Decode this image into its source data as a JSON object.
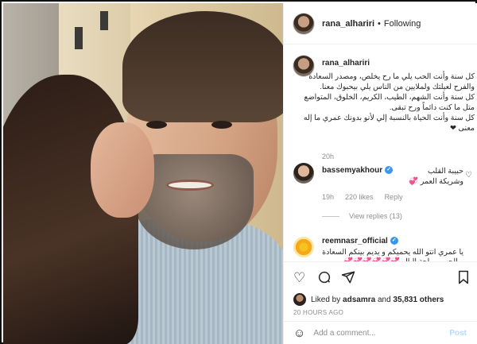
{
  "post_author": {
    "username": "rana_alhariri",
    "follow_separator": "•",
    "follow_status": "Following"
  },
  "caption": {
    "username": "rana_alhariri",
    "text": "كل سنة وأنت الحب يلي ما رح يخلص، ومصدر السعادة والفرح لعيلتك ولملايين من الناس يلي بيحبوك معنا.\nكل سنة وأنت الشهم، الطيب، الكريم، الخلوق، المتواضع متل ما كنت دائماً ورح تبقى.\nكل سنة وأنت الحياة بالنسبة إلي لأنو بدونك عمري ما إله معنى ❤",
    "time": "20h"
  },
  "comments": [
    {
      "username": "bassemyakhour",
      "verified": true,
      "text": "حبيبة القلب وشريكة العمر 💞",
      "time": "19h",
      "likes": "220 likes",
      "reply_label": "Reply",
      "view_replies": "View replies (13)"
    },
    {
      "username": "reemnasr_official",
      "verified": true,
      "text": "يا عمري انتو الله يحميكم و يديم بينكم السعادة و الحب و راحة البال 💞💞💞💞💞💞"
    }
  ],
  "likes_line": {
    "prefix": "Liked by",
    "user": "adsamra",
    "middle": "and",
    "count": "35,831 others"
  },
  "time_ago": "20 HOURS AGO",
  "add_comment": {
    "placeholder": "Add a comment...",
    "post_label": "Post"
  },
  "icons": [
    "heart-icon",
    "comment-icon",
    "share-icon",
    "bookmark-icon",
    "emoji-icon",
    "verified-badge-icon"
  ],
  "colors": {
    "link_blue": "#3897f0",
    "post_disabled": "#b3dbff",
    "secondary_text": "#8e8e8e"
  }
}
